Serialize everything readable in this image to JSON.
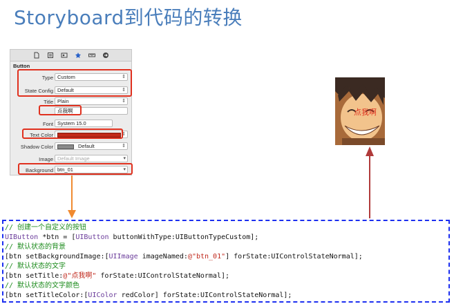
{
  "slide": {
    "title": "Storyboard到代码的转换"
  },
  "inspector": {
    "section": "Button",
    "toolbar_icons": [
      "file-icon",
      "quick-help-icon",
      "identity-icon",
      "attributes-icon",
      "size-icon",
      "connections-icon"
    ],
    "fields": {
      "type": {
        "label": "Type",
        "value": "Custom"
      },
      "state_config": {
        "label": "State Config",
        "value": "Default"
      },
      "title": {
        "label": "Title",
        "value": "Plain"
      },
      "title_text": {
        "value": "点我啊"
      },
      "font": {
        "label": "Font",
        "value": "System 15.0"
      },
      "text_color": {
        "label": "Text Color"
      },
      "shadow_color": {
        "label": "Shadow Color",
        "value": "Default"
      },
      "image": {
        "label": "Image",
        "placeholder": "Default Image"
      },
      "background": {
        "label": "Background",
        "value": "btn_01"
      }
    }
  },
  "preview": {
    "button_text": "点我啊"
  },
  "code": {
    "lines": [
      [
        {
          "t": "// 创建一个自定义的按钮",
          "c": "comment"
        }
      ],
      [
        {
          "t": "UIButton",
          "c": "cls"
        },
        {
          "t": " *btn = [",
          "c": "plain"
        },
        {
          "t": "UIButton",
          "c": "cls"
        },
        {
          "t": " buttonWithType:",
          "c": "plain"
        },
        {
          "t": "UIButtonTypeCustom",
          "c": "plain"
        },
        {
          "t": "];",
          "c": "plain"
        }
      ],
      [
        {
          "t": "// 默认状态的背景",
          "c": "comment"
        }
      ],
      [
        {
          "t": "[btn setBackgroundImage:[",
          "c": "plain"
        },
        {
          "t": "UIImage",
          "c": "cls"
        },
        {
          "t": " imageNamed:",
          "c": "plain"
        },
        {
          "t": "@\"btn_01\"",
          "c": "str"
        },
        {
          "t": "] forState:UIControlStateNormal];",
          "c": "plain"
        }
      ],
      [
        {
          "t": "// 默认状态的文字",
          "c": "comment"
        }
      ],
      [
        {
          "t": "[btn setTitle:",
          "c": "plain"
        },
        {
          "t": "@\"点我啊\"",
          "c": "str"
        },
        {
          "t": " forState:UIControlStateNormal];",
          "c": "plain"
        }
      ],
      [
        {
          "t": "// 默认状态的文字颜色",
          "c": "comment"
        }
      ],
      [
        {
          "t": "[btn setTitleColor:[",
          "c": "plain"
        },
        {
          "t": "UIColor",
          "c": "cls"
        },
        {
          "t": " redColor] forState:UIControlStateNormal];",
          "c": "plain"
        }
      ]
    ]
  },
  "colors": {
    "title": "#4a7ebb",
    "highlight": "#e0301e",
    "orange_arrow": "#f08a30",
    "red_arrow": "#b03a3a",
    "code_border": "#1b2ef0"
  }
}
